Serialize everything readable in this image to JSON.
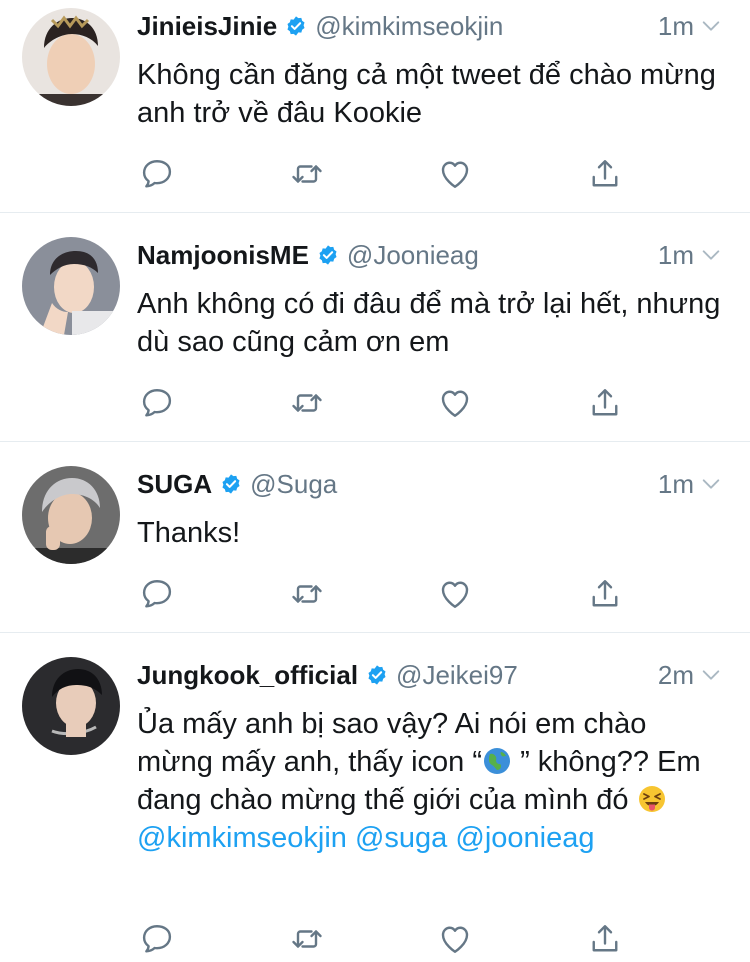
{
  "tweets": [
    {
      "name": "JinieisJinie",
      "handle": "@kimkimseokjin",
      "time": "1m",
      "text": "Không cần đăng cả một tweet để chào mừng anh trở về đâu Kookie",
      "avatar_color": "#3a3230"
    },
    {
      "name": "NamjoonisME",
      "handle": "@Joonieag",
      "time": "1m",
      "text": "Anh không có đi đâu để mà trở lại hết, nhưng dù sao cũng cảm ơn em",
      "avatar_color": "#8a8f9a"
    },
    {
      "name": "SUGA",
      "handle": "@Suga",
      "time": "1m",
      "text": "Thanks!",
      "avatar_color": "#4a4a4a"
    },
    {
      "name": "Jungkook_official",
      "handle": "@Jeikei97",
      "time": "2m",
      "text_part1": "Ủa mấy anh bị sao vậy? Ai nói em chào mừng mấy anh, thấy icon “",
      "emoji_globe": "🌍",
      "text_part2": " ” không?? Em đang chào mừng thế giới của mình đó ",
      "emoji_face": "😝",
      "mentions": [
        "@kimkimseokjin",
        "@suga",
        "@joonieag"
      ],
      "avatar_color": "#2b2b2e"
    }
  ],
  "colors": {
    "accent": "#1da1f2",
    "muted": "#657786",
    "icon": "#657786",
    "text": "#14171a",
    "divider": "#e6ecf0"
  },
  "icons": {
    "reply": "reply-icon",
    "retweet": "retweet-icon",
    "like": "heart-icon",
    "share": "share-icon",
    "verified": "verified-badge-icon",
    "menu": "chevron-down-icon"
  }
}
